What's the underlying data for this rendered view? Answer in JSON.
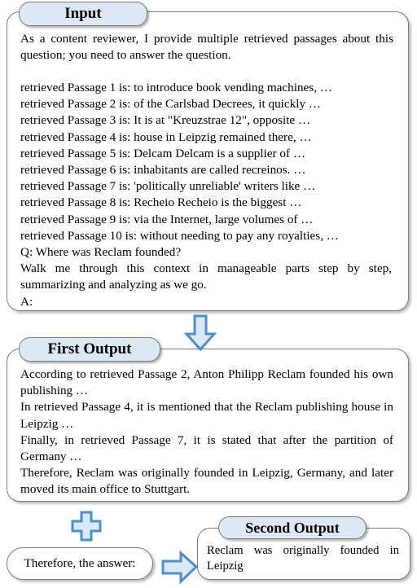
{
  "figure": {
    "type": "prompt-pipeline-diagram"
  },
  "input": {
    "badge_label": "Input",
    "instruction_lines": [
      "As a content reviewer, I provide multiple retrieved passages about",
      "this question; you need to answer the question."
    ],
    "instruction": "As a content reviewer, I provide multiple retrieved passages about this question; you need to answer the question.",
    "passages": [
      "retrieved Passage 1 is: to introduce book vending machines, …",
      "retrieved Passage 2 is: of the Carlsbad Decrees, it quickly …",
      "retrieved Passage 3 is: It is at \"Kreuzstrae 12\", opposite …",
      "retrieved Passage 4 is: house in Leipzig remained there, …",
      "retrieved Passage 5 is: Delcam Delcam is a supplier of …",
      "retrieved Passage 6 is: inhabitants are called recreinos. …",
      "retrieved Passage 7 is: 'politically unreliable' writers like …",
      "retrieved Passage 8 is: Recheio Recheio is the biggest …",
      "retrieved Passage 9 is: via the Internet, large volumes of …",
      "retrieved Passage 10 is: without needing to pay any royalties, …"
    ],
    "question": "Q: Where was Reclam founded?",
    "directive": "Walk me through this context in manageable parts step by step, summarizing and analyzing as we go.",
    "answer_cue": "A:"
  },
  "first_output": {
    "badge_label": "First Output",
    "paragraphs": [
      "According to retrieved Passage 2, Anton Philipp Reclam founded his own publishing …",
      "In retrieved Passage 4, it is mentioned that the Reclam publishing house in Leipzig …",
      "Finally, in retrieved Passage 7, it is stated that after the partition of Germany …",
      "Therefore, Reclam was originally founded in Leipzig, Germany, and later moved its main office to Stuttgart."
    ]
  },
  "answer_prompt": {
    "label": "Therefore, the answer:"
  },
  "second_output": {
    "badge_label": "Second Output",
    "text": "Reclam was originally founded in Leipzig"
  },
  "icons": {
    "arrow_down": "arrow-down-icon",
    "plus": "plus-icon",
    "arrow_right": "arrow-right-icon"
  },
  "colors": {
    "badge_fill": "#dce8f4",
    "panel_border": "#7d7d7d",
    "arrow_fill": "#dbe8f6",
    "arrow_stroke": "#4a8fce",
    "background": "#ffffff"
  }
}
